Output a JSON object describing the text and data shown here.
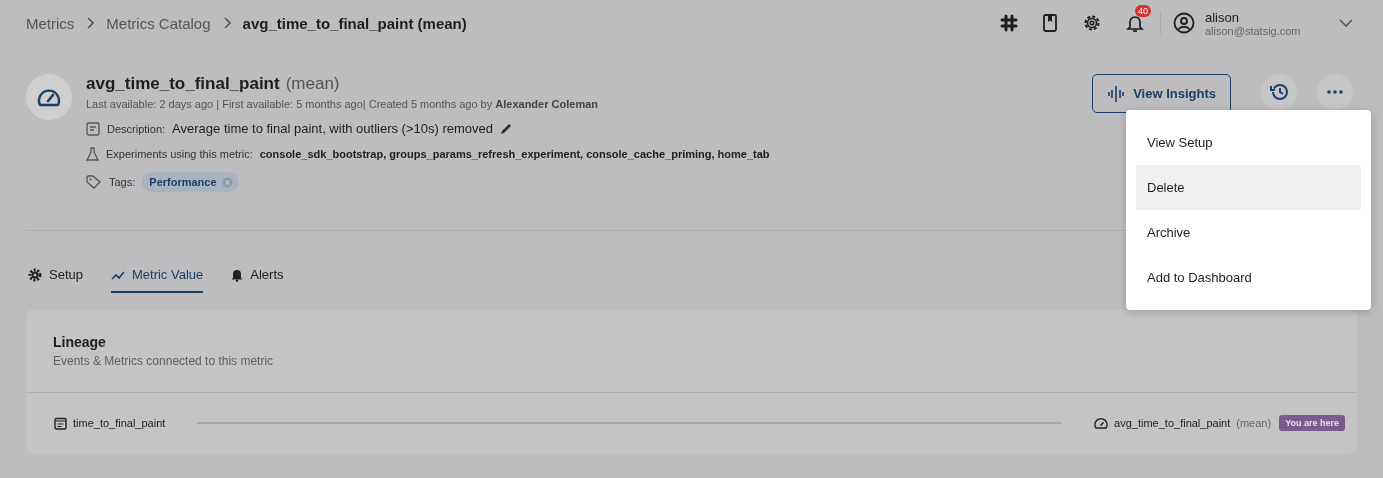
{
  "breadcrumbs": [
    {
      "label": "Metrics",
      "current": false
    },
    {
      "label": "Metrics Catalog",
      "current": false
    },
    {
      "label": "avg_time_to_final_paint (mean)",
      "current": true
    }
  ],
  "topbar": {
    "notifications": "40",
    "user": {
      "name": "alison",
      "email": "alison@statsig.com"
    }
  },
  "metric": {
    "name": "avg_time_to_final_paint",
    "qualifier": "(mean)",
    "meta": "Last available: 2 days ago | First available: 5 months ago| Created 5 months ago by **Alexander Coleman**",
    "description_label": "Description:",
    "description": "Average time to final paint, with outliers (>10s) removed",
    "experiments_label": "Experiments using this metric:",
    "experiments": "console_sdk_bootstrap, groups_params_refresh_experiment, console_cache_priming, home_tab",
    "tags_label": "Tags:",
    "tags": [
      "Performance"
    ]
  },
  "actions": {
    "view_insights": "View Insights"
  },
  "menu": [
    {
      "label": "View Setup",
      "highlighted": false
    },
    {
      "label": "Delete",
      "highlighted": true
    },
    {
      "label": "Archive",
      "highlighted": false
    },
    {
      "label": "Add to Dashboard",
      "highlighted": false
    }
  ],
  "tabs": [
    {
      "label": "Setup",
      "kind": "gear",
      "selected": false
    },
    {
      "label": "Metric Value",
      "kind": "chart",
      "selected": true
    },
    {
      "label": "Alerts",
      "kind": "bell",
      "selected": false
    }
  ],
  "lineage": {
    "title": "Lineage",
    "subtitle": "Events & Metrics connected to this metric",
    "source": "time_to_final_paint",
    "target": {
      "name": "avg_time_to_final_paint",
      "qualifier": "(mean)",
      "badge": "You are here"
    }
  }
}
